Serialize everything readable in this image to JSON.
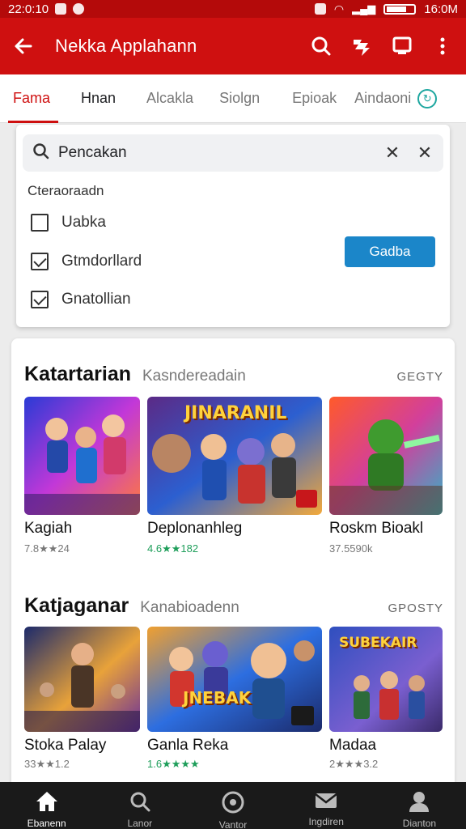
{
  "status_bar": {
    "time": "22:0:10",
    "clock": "16:0M"
  },
  "app_bar": {
    "title": "Nekka Applahann"
  },
  "tabs": [
    {
      "label": "Fama"
    },
    {
      "label": "Hnan"
    },
    {
      "label": "Alcakla"
    },
    {
      "label": "Siolgn"
    },
    {
      "label": "Epioak"
    },
    {
      "label": "Aindaoni"
    }
  ],
  "filter": {
    "search_value": "Pencakan",
    "heading": "Cteraoraadn",
    "options": [
      {
        "label": "Uabka",
        "checked": false
      },
      {
        "label": "Gtmdorllard",
        "checked": true
      },
      {
        "label": "Gnatollian",
        "checked": true
      }
    ],
    "apply_label": "Gadba"
  },
  "sections": [
    {
      "title": "Katartarian",
      "subtitle": "Kasndereadain",
      "more": "GEGTY",
      "items": [
        {
          "title": "Kagiah",
          "rating": "7.8★★24",
          "thumb_text": ""
        },
        {
          "title": "Deplonanhleg",
          "rating": "4.6★★182",
          "thumb_text": "JINARANIL",
          "green": true
        },
        {
          "title": "Roskm Bioakl",
          "rating": "37.5590k",
          "thumb_text": ""
        }
      ]
    },
    {
      "title": "Katjaganar",
      "subtitle": "Kanabioadenn",
      "more": "GPOSTY",
      "items": [
        {
          "title": "Stoka Palay",
          "rating": "33★★1.2",
          "thumb_text": ""
        },
        {
          "title": "Ganla Reka",
          "rating": "1.6★★★★",
          "thumb_text": "JNEBAK",
          "green": true
        },
        {
          "title": "Madaa",
          "rating": "2★★★3.2",
          "thumb_text": "SUBEKAIR"
        }
      ]
    }
  ],
  "bottom_nav": [
    {
      "label": "Ebanenn",
      "icon": "home-icon"
    },
    {
      "label": "Lanor",
      "icon": "search-icon"
    },
    {
      "label": "Vantor",
      "icon": "explore-icon"
    },
    {
      "label": "Ingdiren",
      "icon": "mail-icon"
    },
    {
      "label": "Dianton",
      "icon": "profile-icon"
    }
  ],
  "colors": {
    "primary": "#cf1010",
    "status_bar": "#b40a0a",
    "accent_blue": "#1b86c9",
    "rating_green": "#1e9e5a",
    "nav_bg": "#1a1a1a"
  }
}
